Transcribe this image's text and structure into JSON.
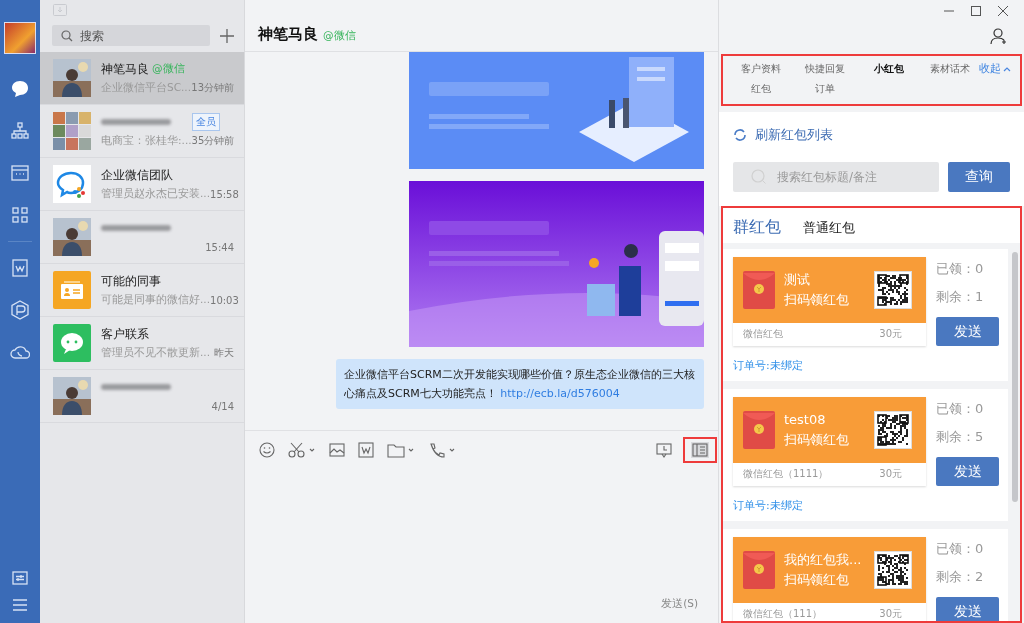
{
  "search": {
    "placeholder": "搜索"
  },
  "chats": [
    {
      "name": "神笔马良",
      "tag": "@微信",
      "preview": "企业微信平台SC...",
      "time": "13分钟前",
      "selected": true
    },
    {
      "kind": "group",
      "badge": "全员",
      "preview": "电商宝：张桂华:...",
      "time": "35分钟前",
      "selected": false
    },
    {
      "kind": "wecom",
      "name": "企业微信团队",
      "preview": "管理员赵永杰已安装...",
      "time": "15:58",
      "selected": false
    },
    {
      "time": "15:44",
      "selected": false
    },
    {
      "kind": "colleague",
      "name": "可能的同事",
      "preview": "可能是同事的微信好...",
      "time": "10:03",
      "selected": false
    },
    {
      "kind": "contact",
      "name": "客户联系",
      "preview": "管理员不见不散更新...",
      "time": "昨天",
      "selected": false
    },
    {
      "time": "4/14",
      "selected": false
    }
  ],
  "conversation": {
    "title": "神笔马良",
    "tag": "@微信",
    "message": {
      "text": "企业微信平台SCRM二次开发能实现哪些价值？原生态企业微信的三大核心痛点及SCRM七大功能亮点！",
      "link": "http://ecb.la/d576004"
    },
    "send_hint": "发送(S)"
  },
  "panel": {
    "tabs": [
      {
        "label": "客户资料",
        "selected": false
      },
      {
        "label": "快捷回复",
        "selected": false
      },
      {
        "label": "小红包",
        "selected": true
      },
      {
        "label": "素材话术",
        "selected": false
      },
      {
        "label": "红包",
        "selected": false
      },
      {
        "label": "订单",
        "selected": false
      }
    ],
    "collapse": "收起",
    "refresh": "刷新红包列表",
    "search": {
      "placeholder": "搜索红包标题/备注"
    },
    "query_button": "查询",
    "subtabs": [
      {
        "label": "群红包",
        "selected": true
      },
      {
        "label": "普通红包",
        "selected": false
      }
    ],
    "packets": [
      {
        "title": "测试",
        "subtitle": "扫码领红包",
        "source": "微信红包",
        "amount": "30元",
        "claimed": "已领：0",
        "remaining": "剩余：1",
        "button": "发送",
        "order": "订单号:未绑定"
      },
      {
        "title": "test08",
        "subtitle": "扫码领红包",
        "source": "微信红包（1111）",
        "amount": "30元",
        "claimed": "已领：0",
        "remaining": "剩余：5",
        "button": "发送",
        "order": "订单号:未绑定"
      },
      {
        "title": "我的红包我...",
        "subtitle": "扫码领红包",
        "source": "微信红包（111）",
        "amount": "30元",
        "claimed": "已领：0",
        "remaining": "剩余：2",
        "button": "发送"
      }
    ]
  }
}
